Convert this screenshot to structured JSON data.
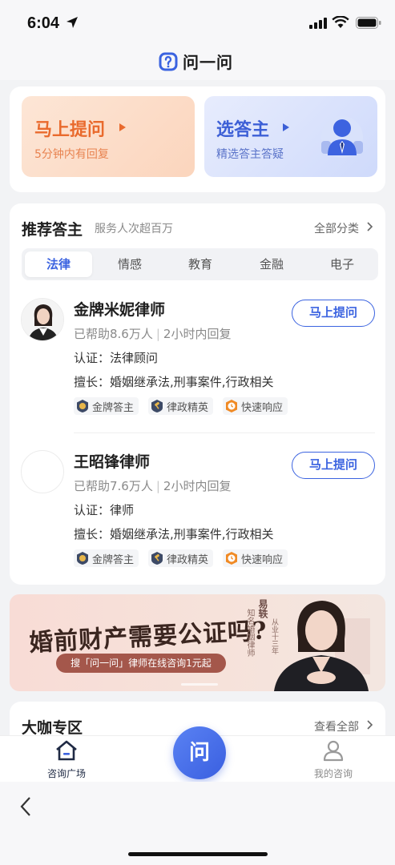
{
  "status": {
    "time": "6:04"
  },
  "app": {
    "title": "问一问"
  },
  "quick_actions": {
    "ask": {
      "title": "马上提问",
      "subtitle": "5分钟内有回复"
    },
    "pick": {
      "title": "选答主",
      "subtitle": "精选答主答疑"
    }
  },
  "recommend": {
    "title": "推荐答主",
    "subtitle": "服务人次超百万",
    "all_label": "全部分类",
    "tabs": [
      "法律",
      "情感",
      "教育",
      "金融",
      "电子"
    ],
    "active_tab": "法律",
    "lawyers": [
      {
        "name": "金牌米妮律师",
        "helped": "已帮助8.6万人",
        "reply": "2小时内回复",
        "cert": "认证：法律顾问",
        "skill": "擅长：婚姻继承法,刑事案件,行政相关",
        "button": "马上提问",
        "badges": [
          "金牌答主",
          "律政精英",
          "快速响应"
        ]
      },
      {
        "name": "王昭锋律师",
        "helped": "已帮助7.6万人",
        "reply": "2小时内回复",
        "cert": "认证：律师",
        "skill": "擅长：婚姻继承法,刑事案件,行政相关",
        "button": "马上提问",
        "badges": [
          "金牌答主",
          "律政精英",
          "快速响应"
        ]
      }
    ]
  },
  "banner": {
    "headline": "婚前财产需要公证吗?",
    "sub": "搜「问一问」律师在线咨询1元起",
    "person_name": "易轶",
    "person_role": "知名婚姻律师",
    "person_exp": "从业十三年"
  },
  "vip": {
    "title": "大咖专区",
    "all_label": "查看全部"
  },
  "tabbar": {
    "left": "咨询广场",
    "center": "问",
    "right": "我的咨询"
  },
  "colors": {
    "accent": "#3b63e0",
    "orange": "#e96a2d"
  }
}
